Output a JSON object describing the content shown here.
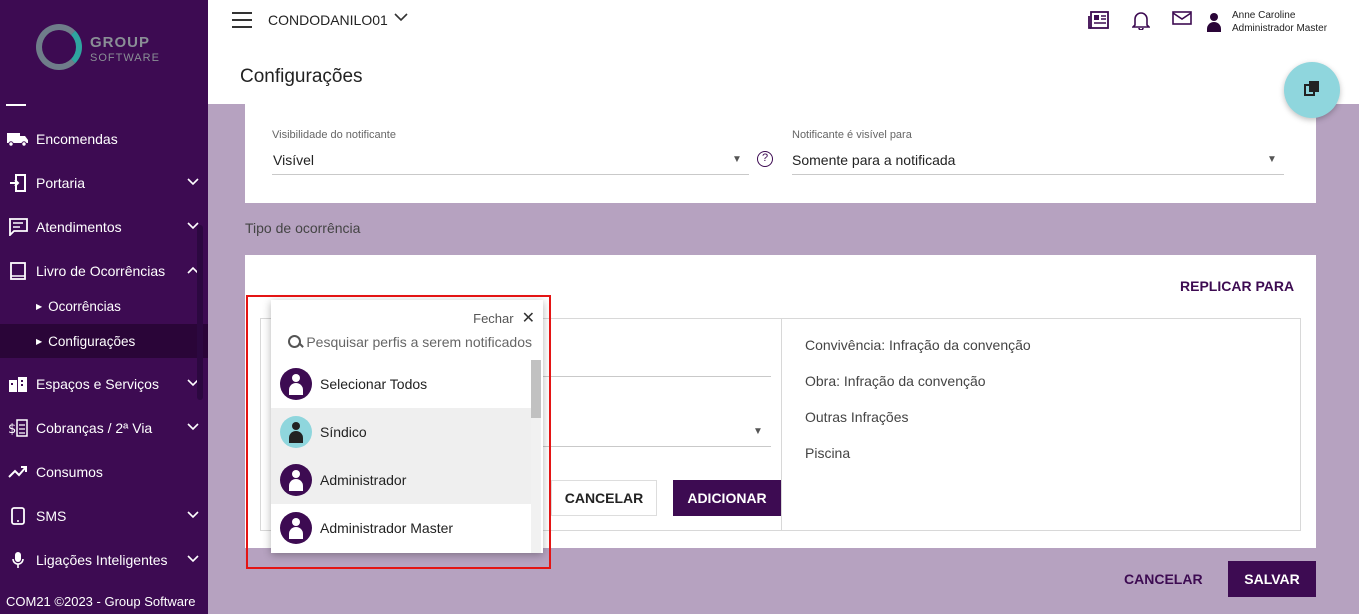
{
  "sidebar": {
    "logo_line1": "GROUP",
    "logo_line2": "SOFTWARE",
    "items": [
      {
        "label": "Encomendas",
        "icon": "truck-icon"
      },
      {
        "label": "Portaria",
        "icon": "door-icon"
      },
      {
        "label": "Atendimentos",
        "icon": "chat-icon"
      },
      {
        "label": "Livro de Ocorrências",
        "icon": "book-icon"
      },
      {
        "label": "Espaços e Serviços",
        "icon": "building-icon"
      },
      {
        "label": "Cobranças / 2ª Via",
        "icon": "billing-icon"
      },
      {
        "label": "Consumos",
        "icon": "trend-icon"
      },
      {
        "label": "SMS",
        "icon": "phone-icon"
      },
      {
        "label": "Ligações Inteligentes",
        "icon": "microphone-icon"
      }
    ],
    "subitems": [
      {
        "label": "Ocorrências"
      },
      {
        "label": "Configurações"
      }
    ],
    "footer": "COM21 ©2023 - Group Software"
  },
  "topbar": {
    "condo": "CONDODANILO01",
    "user_name": "Anne Caroline",
    "user_role": "Administrador Master"
  },
  "page": {
    "title": "Configurações"
  },
  "card1": {
    "vis_label": "Visibilidade do notificante",
    "vis_value": "Visível",
    "for_label": "Notificante é visível para",
    "for_value": "Somente para a notificada"
  },
  "section": {
    "label": "Tipo de ocorrência"
  },
  "card2": {
    "replicar": "REPLICAR PARA",
    "occurrences": [
      "Convivência: Infração da convenção",
      "Obra: Infração da convenção",
      "Outras Infrações",
      "Piscina"
    ],
    "cancel": "CANCELAR",
    "add": "ADICIONAR"
  },
  "popup": {
    "close_label": "Fechar",
    "search_placeholder": "Pesquisar perfis a serem notificados",
    "options": [
      {
        "label": "Selecionar Todos"
      },
      {
        "label": "Síndico"
      },
      {
        "label": "Administrador"
      },
      {
        "label": "Administrador Master"
      }
    ]
  },
  "footer_actions": {
    "cancel": "CANCELAR",
    "save": "SALVAR"
  },
  "colors": {
    "primary": "#3d0b52",
    "accent": "#8fd6dd",
    "background": "#b6a2c0",
    "highlight": "#e41414"
  }
}
